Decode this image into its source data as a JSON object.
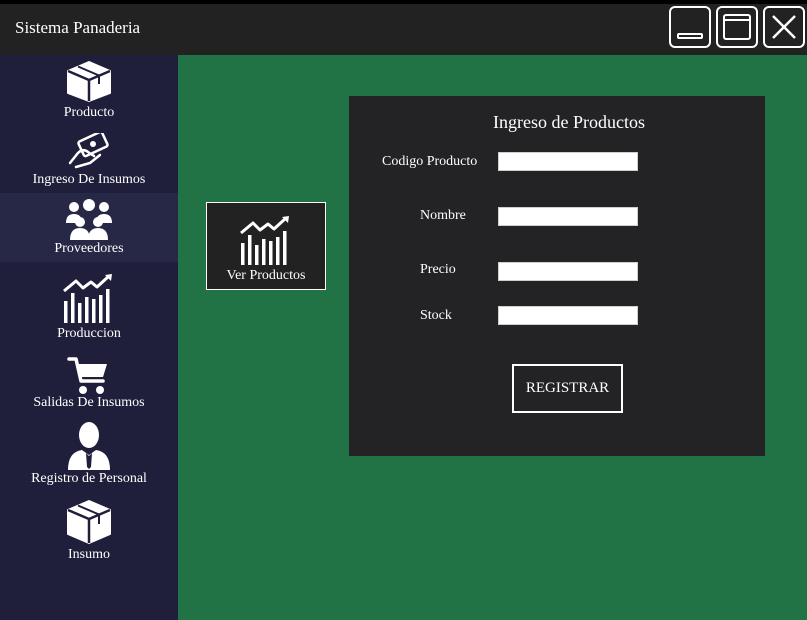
{
  "window": {
    "title": "Sistema Panaderia",
    "controls": [
      "minimize-icon",
      "maximize-icon",
      "close-icon"
    ]
  },
  "sidebar": {
    "items": [
      {
        "label": "Producto",
        "icon": "box-icon"
      },
      {
        "label": "Ingreso De Insumos",
        "icon": "money-hand-icon"
      },
      {
        "label": "Proveedores",
        "icon": "people-group-icon",
        "active": true
      },
      {
        "label": "Produccion",
        "icon": "chart-icon"
      },
      {
        "label": "Salidas De Insumos",
        "icon": "cart-icon"
      },
      {
        "label": "Registro de Personal",
        "icon": "person-icon"
      },
      {
        "label": "Insumo",
        "icon": "box-icon"
      }
    ]
  },
  "main": {
    "ver_productos": {
      "label": "Ver Productos",
      "icon": "chart-icon"
    },
    "form": {
      "title": "Ingreso de Productos",
      "fields": [
        {
          "label": "Codigo Producto",
          "value": ""
        },
        {
          "label": "Nombre",
          "value": ""
        },
        {
          "label": "Precio",
          "value": ""
        },
        {
          "label": "Stock",
          "value": ""
        }
      ],
      "submit_label": "REGISTRAR"
    }
  },
  "colors": {
    "sidebar": "#1f1f3c",
    "sidebar_active": "#272746",
    "main_background": "#217346",
    "panel": "#232326",
    "titlebar": "#222222"
  }
}
